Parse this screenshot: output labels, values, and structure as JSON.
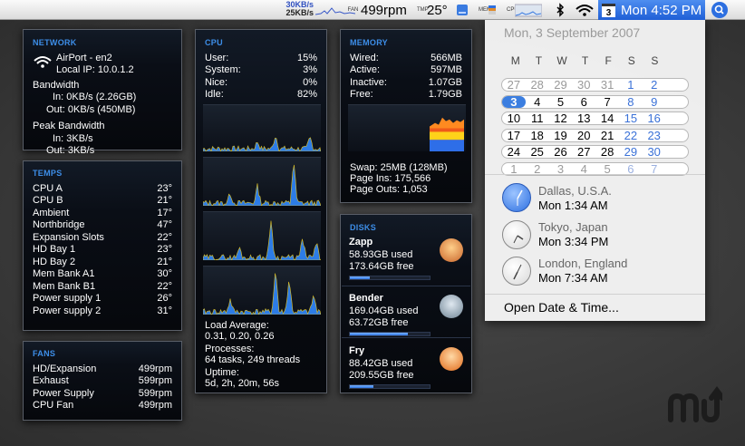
{
  "menubar": {
    "net_up": "30KB/s",
    "net_down": "25KB/s",
    "fan_label": "FAN",
    "fan_value": "499rpm",
    "temp_label": "TMP",
    "temp_value": "25°",
    "mem_label": "MEM",
    "cpu_label": "CPU",
    "calendar_icon_day": "3",
    "clock": "Mon 4:52 PM"
  },
  "network": {
    "title": "NETWORK",
    "iface": "AirPort - en2",
    "local_ip": "Local IP: 10.0.1.2",
    "bw_label": "Bandwidth",
    "bw_in_label": "In:",
    "bw_in": "0KB/s (2.26GB)",
    "bw_out_label": "Out:",
    "bw_out": "0KB/s (450MB)",
    "peak_label": "Peak Bandwidth",
    "peak_in_label": "In:",
    "peak_in": "3KB/s",
    "peak_out_label": "Out:",
    "peak_out": "3KB/s"
  },
  "temps": {
    "title": "TEMPS",
    "rows": [
      {
        "label": "CPU A",
        "value": "23°"
      },
      {
        "label": "CPU B",
        "value": "21°"
      },
      {
        "label": "Ambient",
        "value": "17°"
      },
      {
        "label": "Northbridge",
        "value": "47°"
      },
      {
        "label": "Expansion Slots",
        "value": "22°"
      },
      {
        "label": "HD Bay 1",
        "value": "23°"
      },
      {
        "label": "HD Bay 2",
        "value": "21°"
      },
      {
        "label": "Mem Bank A1",
        "value": "30°"
      },
      {
        "label": "Mem Bank B1",
        "value": "22°"
      },
      {
        "label": "Power supply 1",
        "value": "26°"
      },
      {
        "label": "Power supply 2",
        "value": "31°"
      }
    ]
  },
  "fans": {
    "title": "FANS",
    "rows": [
      {
        "label": "HD/Expansion",
        "value": "499rpm"
      },
      {
        "label": "Exhaust",
        "value": "599rpm"
      },
      {
        "label": "Power Supply",
        "value": "599rpm"
      },
      {
        "label": "CPU Fan",
        "value": "499rpm"
      }
    ]
  },
  "cpu": {
    "title": "CPU",
    "rows": [
      {
        "label": "User:",
        "value": "15%"
      },
      {
        "label": "System:",
        "value": "3%"
      },
      {
        "label": "Nice:",
        "value": "0%"
      },
      {
        "label": "Idle:",
        "value": "82%"
      }
    ],
    "load_label": "Load Average:",
    "load_value": "0.31, 0.20, 0.26",
    "proc_label": "Processes:",
    "proc_value": "64 tasks, 249 threads",
    "uptime_label": "Uptime:",
    "uptime_value": "5d, 2h, 20m, 56s"
  },
  "memory": {
    "title": "MEMORY",
    "rows": [
      {
        "label": "Wired:",
        "value": "566MB"
      },
      {
        "label": "Active:",
        "value": "597MB"
      },
      {
        "label": "Inactive:",
        "value": "1.07GB"
      },
      {
        "label": "Free:",
        "value": "1.79GB"
      }
    ],
    "swap": "Swap: 25MB (128MB)",
    "pageins": "Page Ins: 175,566",
    "pageouts": "Page Outs: 1,053"
  },
  "disks": {
    "title": "DISKS",
    "items": [
      {
        "name": "Zapp",
        "used": "58.93GB used",
        "free": "173.64GB free",
        "fraction": 0.25
      },
      {
        "name": "Bender",
        "used": "169.04GB used",
        "free": "63.72GB free",
        "fraction": 0.73
      },
      {
        "name": "Fry",
        "used": "88.42GB used",
        "free": "209.55GB free",
        "fraction": 0.3
      }
    ]
  },
  "calendar": {
    "date_header": "Mon, 3 September 2007",
    "weekdays": [
      "M",
      "T",
      "W",
      "T",
      "F",
      "S",
      "S"
    ],
    "weeks": [
      [
        "27",
        "28",
        "29",
        "30",
        "31",
        "1",
        "2"
      ],
      [
        "3",
        "4",
        "5",
        "6",
        "7",
        "8",
        "9"
      ],
      [
        "10",
        "11",
        "12",
        "13",
        "14",
        "15",
        "16"
      ],
      [
        "17",
        "18",
        "19",
        "20",
        "21",
        "22",
        "23"
      ],
      [
        "24",
        "25",
        "26",
        "27",
        "28",
        "29",
        "30"
      ],
      [
        "1",
        "2",
        "3",
        "4",
        "5",
        "6",
        "7"
      ]
    ],
    "today": "3"
  },
  "world_clocks": [
    {
      "city": "Dallas, U.S.A.",
      "time": "Mon 1:34 AM"
    },
    {
      "city": "Tokyo, Japan",
      "time": "Mon 3:34 PM"
    },
    {
      "city": "London, England",
      "time": "Mon 7:34 AM"
    }
  ],
  "open_datetime": "Open Date & Time..."
}
